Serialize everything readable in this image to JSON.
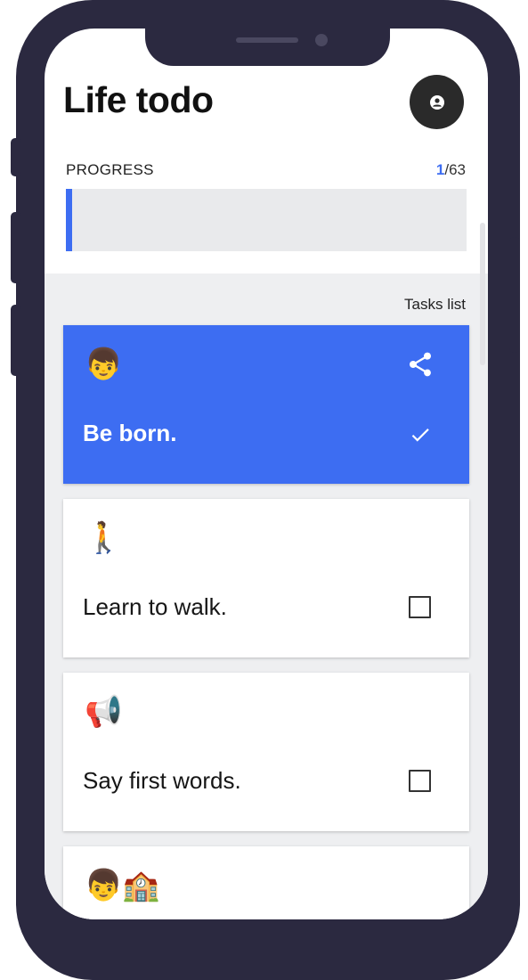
{
  "app": {
    "title": "Life todo"
  },
  "progress": {
    "label": "PROGRESS",
    "current": "1",
    "total": "63",
    "fraction": 0.016
  },
  "tasks_heading": "Tasks list",
  "tasks": [
    {
      "emoji": "👦",
      "title": "Be born.",
      "done": true
    },
    {
      "emoji": "🚶",
      "title": "Learn to walk.",
      "done": false
    },
    {
      "emoji": "📢",
      "title": "Say first words.",
      "done": false
    },
    {
      "emoji": "👦🏫",
      "title": "",
      "done": false
    }
  ],
  "icons": {
    "avatar": "account-circle-icon",
    "share": "share-icon",
    "done": "check-icon",
    "pending": "checkbox-icon"
  },
  "colors": {
    "accent": "#3d6df2",
    "phone_frame": "#2b2940",
    "list_background": "#eeeff1"
  }
}
